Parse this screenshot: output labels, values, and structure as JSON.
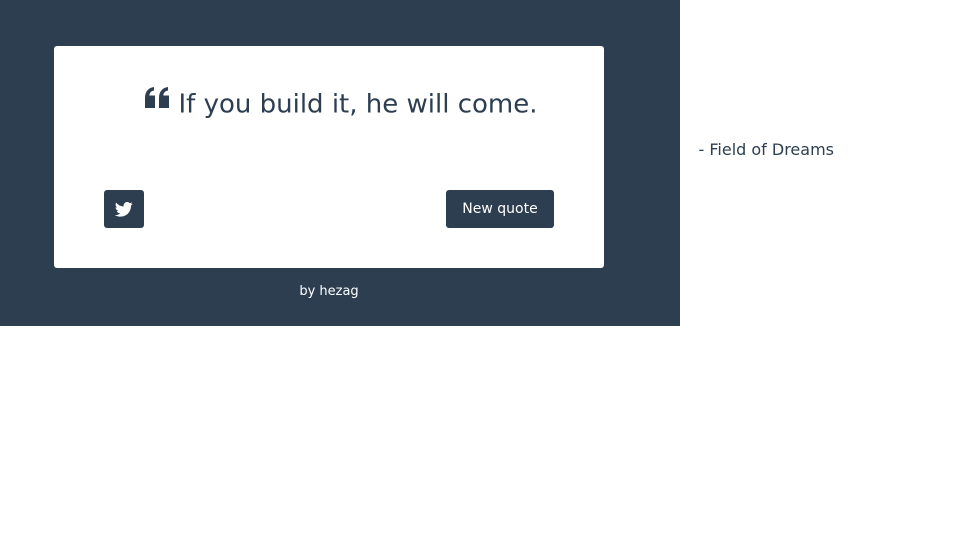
{
  "quote": {
    "text": "If you build it, he will come.",
    "author": "- Field of Dreams",
    "icon": "quote-left-icon"
  },
  "actions": {
    "tweet_icon": "twitter-icon",
    "new_quote_label": "New quote"
  },
  "footer": {
    "prefix": "by",
    "author_link": "hezag"
  },
  "colors": {
    "panel_background": "#2c3e50",
    "card_background": "#ffffff",
    "accent": "#2c3e50",
    "button_text": "#ffffff"
  }
}
